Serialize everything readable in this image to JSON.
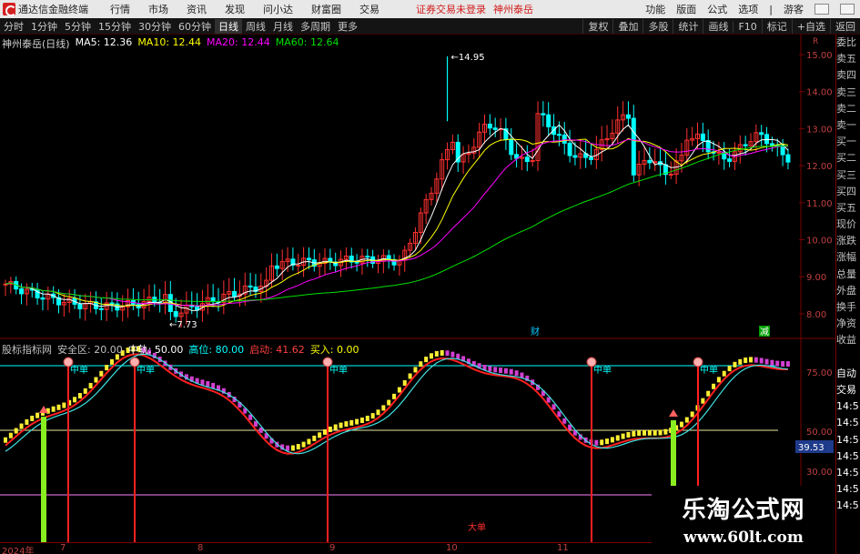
{
  "titlebar": {
    "app_name": "通达信金融终端",
    "menus": [
      "行情",
      "市场",
      "资讯",
      "发现",
      "问小达",
      "财富圈",
      "交易"
    ],
    "notice": "证券交易未登录",
    "stock": "神州泰岳",
    "right_menus": [
      "功能",
      "版面",
      "公式",
      "选项",
      "|",
      "游客"
    ]
  },
  "toolbar": {
    "periods": [
      "分时",
      "1分钟",
      "5分钟",
      "15分钟",
      "30分钟",
      "60分钟",
      "日线",
      "周线",
      "月线",
      "多周期",
      "更多"
    ],
    "active_period": "日线",
    "tools": [
      "复权",
      "叠加",
      "多股",
      "统计",
      "画线",
      "F10",
      "标记",
      "+自选",
      "返回"
    ]
  },
  "main_header": {
    "name": "神州泰岳(日线)",
    "ma5": "MA5: 12.36",
    "ma10": "MA10: 12.44",
    "ma20": "MA20: 12.44",
    "ma60": "MA60: 12.64"
  },
  "price_axis": {
    "labels": [
      "15.00",
      "14.00",
      "13.00",
      "12.00",
      "11.00",
      "10.00",
      "9.00",
      "8.00"
    ],
    "top_marker": "R"
  },
  "price_annotations": {
    "high": "14.95",
    "low": "7.73",
    "cai_mark": "财",
    "jian_mark": "减"
  },
  "sub_header": {
    "name": "股标指标网",
    "safe": "安全区: 20.00",
    "mid": "中轨: 50.00",
    "high": "高位: 80.00",
    "start": "启动: 41.62",
    "buy": "买入: 0.00"
  },
  "indicator_axis": {
    "labels": [
      "75.00",
      "50.00",
      "30.00"
    ],
    "current_value": "39.53"
  },
  "signal_labels": {
    "mid": "中单",
    "big": "大单"
  },
  "side_panel": [
    "委比",
    "卖五",
    "卖四",
    "卖三",
    "卖二",
    "卖一",
    "买一",
    "买二",
    "买三",
    "买四",
    "买五",
    "现价",
    "涨跌",
    "涨幅",
    "总量",
    "外盘",
    "换手",
    "净资",
    "收益",
    "",
    "自动",
    "交易",
    "14:5",
    "14:5",
    "14:5",
    "14:5",
    "14:5",
    "14:5",
    "14:5"
  ],
  "date_axis": [
    "2024年",
    "7",
    "8",
    "9",
    "10",
    "11"
  ],
  "watermark": {
    "line1": "乐淘公式网",
    "line2": "www.60lt.com"
  },
  "colors": {
    "up": "#ff3030",
    "down": "#00ffff",
    "ma5": "#ffffff",
    "ma10": "#ffff00",
    "ma20": "#ff00ff",
    "ma60": "#00e000",
    "border": "#7a0000"
  }
}
